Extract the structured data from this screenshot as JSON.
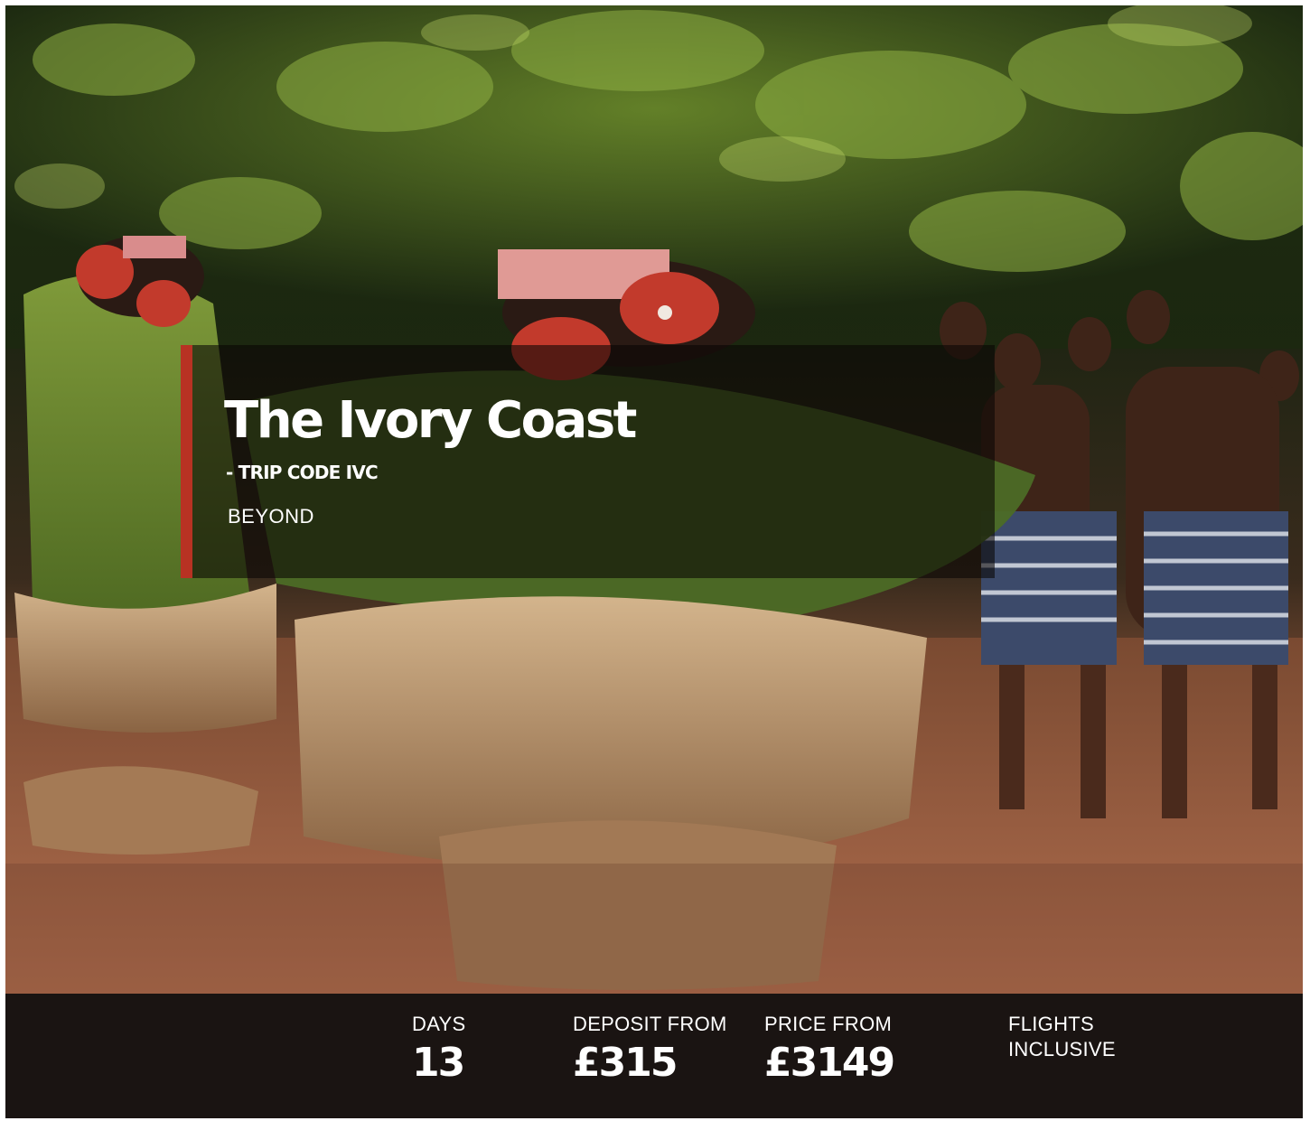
{
  "hero": {
    "image": "ivory-coast-mask-dance-photo",
    "title": "The Ivory Coast",
    "trip_code": "- TRIP CODE IVC",
    "category": "BEYOND",
    "accent_color": "#b83223"
  },
  "stats": {
    "days_label": "DAYS",
    "days_value": "13",
    "deposit_label": "DEPOSIT FROM",
    "deposit_value": "£315",
    "price_label": "PRICE FROM",
    "price_value": "£3149",
    "flights_line1": "FLIGHTS",
    "flights_line2": "INCLUSIVE"
  },
  "colors": {
    "stats_bar_background": "#1a1412",
    "text": "#ffffff"
  }
}
